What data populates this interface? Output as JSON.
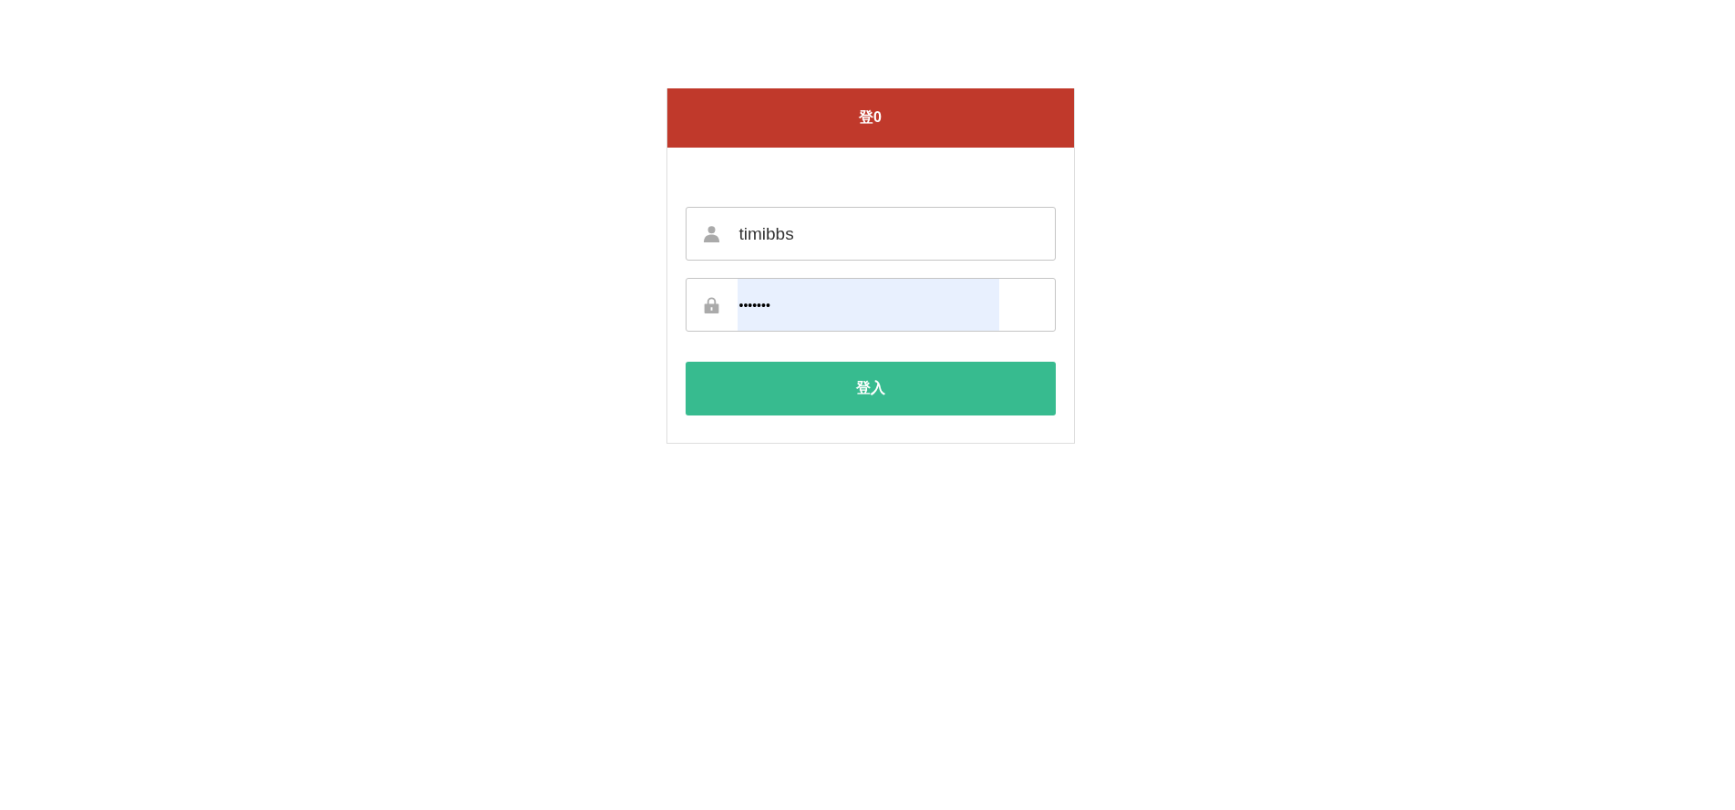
{
  "header": {
    "title": "登0"
  },
  "fields": [
    {
      "kind": "user",
      "value": "timibbs"
    },
    {
      "kind": "password",
      "value": "•••••••"
    }
  ],
  "submit": {
    "label": "登入"
  }
}
